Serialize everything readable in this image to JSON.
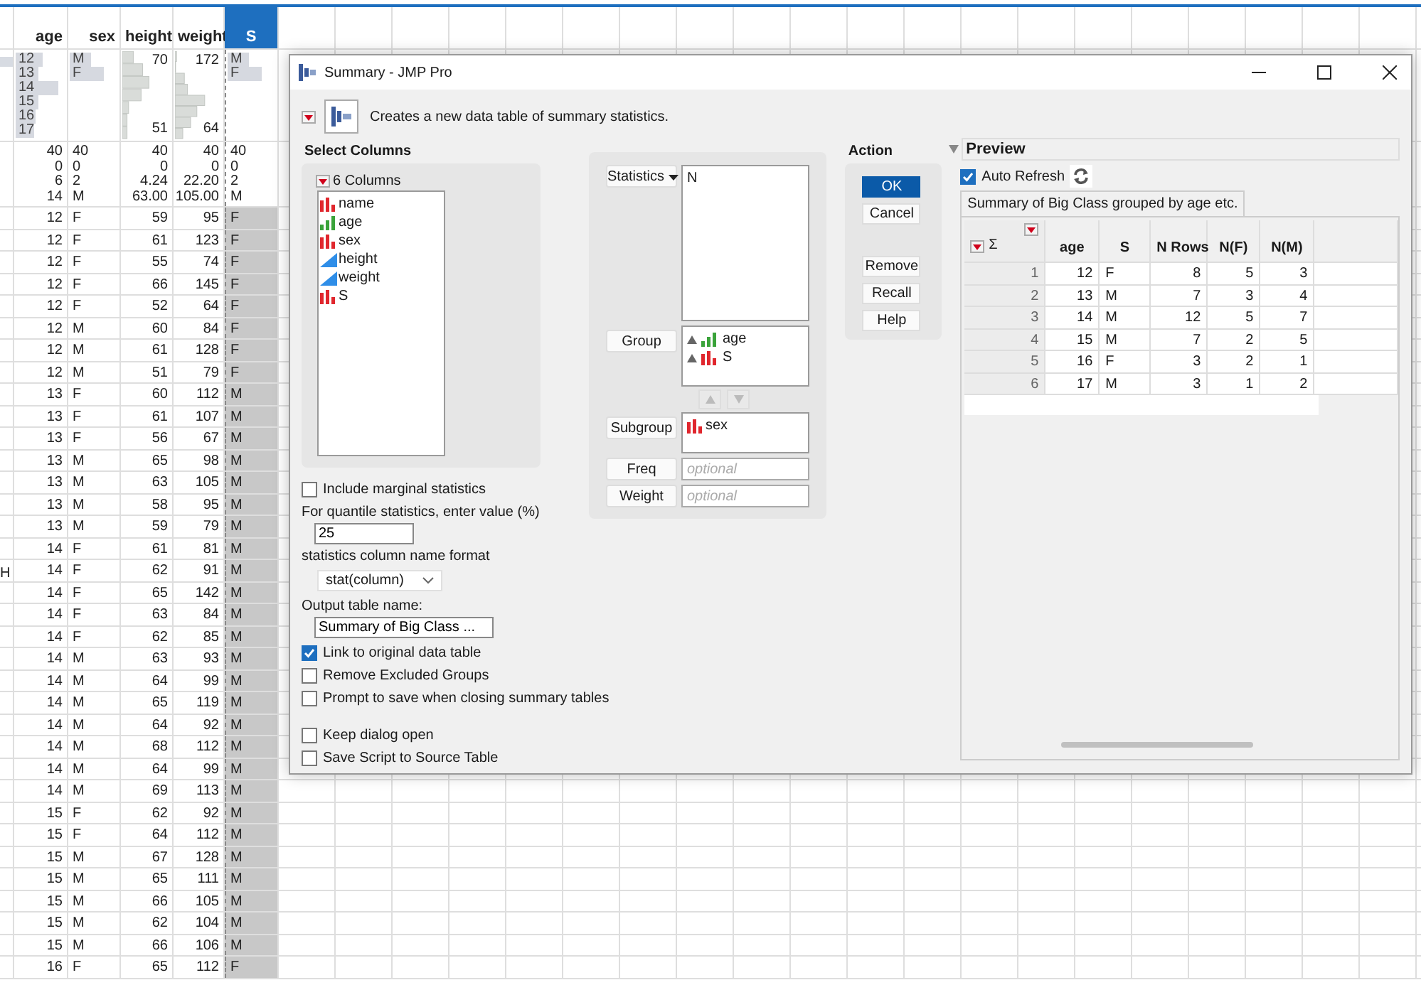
{
  "data_table": {
    "columns": [
      {
        "header": "age",
        "selected": false,
        "distribution": {
          "kind": "levels",
          "labels": [
            "12",
            "13",
            "14",
            "15",
            "16",
            "17"
          ]
        },
        "stats": [
          "40",
          "0",
          "6",
          "14"
        ]
      },
      {
        "header": "sex",
        "selected": false,
        "distribution": {
          "kind": "levels",
          "labels": [
            "M",
            "F"
          ]
        },
        "stats": [
          "40",
          "0",
          "2",
          "M"
        ]
      },
      {
        "header": "height",
        "selected": false,
        "distribution": {
          "kind": "histogram",
          "max": "70",
          "min": "51"
        },
        "stats": [
          "40",
          "0",
          "4.24",
          "63.00"
        ]
      },
      {
        "header": "weight",
        "selected": false,
        "distribution": {
          "kind": "histogram",
          "max": "172",
          "min": "64"
        },
        "stats": [
          "40",
          "0",
          "22.20",
          "105.00"
        ]
      },
      {
        "header": "S",
        "selected": true,
        "distribution": {
          "kind": "levels",
          "labels": [
            "M",
            "F"
          ]
        },
        "stats": [
          "40",
          "0",
          "2",
          "M"
        ]
      }
    ],
    "rows": [
      {
        "cells": [
          "12",
          "F",
          "59",
          "95",
          "F"
        ]
      },
      {
        "cells": [
          "12",
          "F",
          "61",
          "123",
          "F"
        ]
      },
      {
        "cells": [
          "12",
          "F",
          "55",
          "74",
          "F"
        ]
      },
      {
        "cells": [
          "12",
          "F",
          "66",
          "145",
          "F"
        ]
      },
      {
        "cells": [
          "12",
          "F",
          "52",
          "64",
          "F"
        ]
      },
      {
        "cells": [
          "12",
          "M",
          "60",
          "84",
          "F"
        ]
      },
      {
        "cells": [
          "12",
          "M",
          "61",
          "128",
          "F"
        ]
      },
      {
        "cells": [
          "12",
          "M",
          "51",
          "79",
          "F"
        ]
      },
      {
        "cells": [
          "13",
          "F",
          "60",
          "112",
          "M"
        ]
      },
      {
        "cells": [
          "13",
          "F",
          "61",
          "107",
          "M"
        ]
      },
      {
        "cells": [
          "13",
          "F",
          "56",
          "67",
          "M"
        ]
      },
      {
        "cells": [
          "13",
          "M",
          "65",
          "98",
          "M"
        ]
      },
      {
        "cells": [
          "13",
          "M",
          "63",
          "105",
          "M"
        ]
      },
      {
        "cells": [
          "13",
          "M",
          "58",
          "95",
          "M"
        ]
      },
      {
        "cells": [
          "13",
          "M",
          "59",
          "79",
          "M"
        ]
      },
      {
        "cells": [
          "14",
          "F",
          "61",
          "81",
          "M"
        ]
      },
      {
        "name_fragment": "H",
        "cells": [
          "14",
          "F",
          "62",
          "91",
          "M"
        ]
      },
      {
        "cells": [
          "14",
          "F",
          "65",
          "142",
          "M"
        ]
      },
      {
        "cells": [
          "14",
          "F",
          "63",
          "84",
          "M"
        ]
      },
      {
        "cells": [
          "14",
          "F",
          "62",
          "85",
          "M"
        ]
      },
      {
        "cells": [
          "14",
          "M",
          "63",
          "93",
          "M"
        ]
      },
      {
        "cells": [
          "14",
          "M",
          "64",
          "99",
          "M"
        ]
      },
      {
        "cells": [
          "14",
          "M",
          "65",
          "119",
          "M"
        ]
      },
      {
        "cells": [
          "14",
          "M",
          "64",
          "92",
          "M"
        ]
      },
      {
        "cells": [
          "14",
          "M",
          "68",
          "112",
          "M"
        ]
      },
      {
        "cells": [
          "14",
          "M",
          "64",
          "99",
          "M"
        ]
      },
      {
        "cells": [
          "14",
          "M",
          "69",
          "113",
          "M"
        ]
      },
      {
        "cells": [
          "15",
          "F",
          "62",
          "92",
          "M"
        ]
      },
      {
        "cells": [
          "15",
          "F",
          "64",
          "112",
          "M"
        ]
      },
      {
        "cells": [
          "15",
          "M",
          "67",
          "128",
          "M"
        ]
      },
      {
        "cells": [
          "15",
          "M",
          "65",
          "111",
          "M"
        ]
      },
      {
        "cells": [
          "15",
          "M",
          "66",
          "105",
          "M"
        ]
      },
      {
        "cells": [
          "15",
          "M",
          "62",
          "104",
          "M"
        ]
      },
      {
        "cells": [
          "15",
          "M",
          "66",
          "106",
          "M"
        ]
      },
      {
        "cells": [
          "16",
          "F",
          "65",
          "112",
          "F"
        ]
      }
    ]
  },
  "dialog": {
    "title": "Summary - JMP Pro",
    "description": "Creates a new data table of summary statistics.",
    "select_columns": {
      "heading": "Select Columns",
      "count_label": "6 Columns",
      "items": [
        {
          "name": "name",
          "kind": "nominal"
        },
        {
          "name": "age",
          "kind": "ordinal"
        },
        {
          "name": "sex",
          "kind": "nominal"
        },
        {
          "name": "height",
          "kind": "continuous"
        },
        {
          "name": "weight",
          "kind": "continuous"
        },
        {
          "name": "S",
          "kind": "nominal"
        }
      ]
    },
    "marginal": {
      "label": "Include marginal statistics",
      "checked": false
    },
    "quantile": {
      "label": "For quantile statistics, enter value (%)",
      "value": "25"
    },
    "name_format": {
      "label": "statistics column name format",
      "value": "stat(column)"
    },
    "output_name": {
      "label": "Output table name:",
      "value": "Summary of Big Class ..."
    },
    "checkboxes": [
      {
        "label": "Link to original data table",
        "checked": true
      },
      {
        "label": "Remove Excluded Groups",
        "checked": false
      },
      {
        "label": "Prompt to save when closing summary tables",
        "checked": false
      }
    ],
    "checkboxes_2": [
      {
        "label": "Keep dialog open",
        "checked": false
      },
      {
        "label": "Save Script to Source Table",
        "checked": false
      }
    ],
    "roles": [
      {
        "button": "Statistics",
        "kind": "menu",
        "items": [
          {
            "name": "N"
          }
        ]
      },
      {
        "button": "Group",
        "kind": "ordered",
        "items": [
          {
            "name": "age",
            "kind": "ordinal"
          },
          {
            "name": "S",
            "kind": "nominal"
          }
        ]
      },
      {
        "button": "Subgroup",
        "kind": "list",
        "items": [
          {
            "name": "sex",
            "kind": "nominal"
          }
        ]
      },
      {
        "button": "Freq",
        "kind": "optional",
        "placeholder": "optional"
      },
      {
        "button": "Weight",
        "kind": "optional",
        "placeholder": "optional"
      }
    ],
    "action": {
      "heading": "Action",
      "buttons": [
        {
          "label": "OK",
          "primary": true
        },
        {
          "label": "Cancel",
          "primary": false
        }
      ],
      "buttons_2": [
        {
          "label": "Remove"
        },
        {
          "label": "Recall"
        },
        {
          "label": "Help"
        }
      ]
    },
    "preview": {
      "heading": "Preview",
      "auto_refresh": {
        "label": "Auto Refresh",
        "checked": true
      },
      "tab": "Summary of Big Class grouped by age etc.",
      "corner_symbol": "Σ",
      "columns": [
        "age",
        "S",
        "N Rows",
        "N(F)",
        "N(M)"
      ],
      "rows": [
        {
          "number": "1",
          "cells": [
            "12",
            "F",
            "8",
            "5",
            "3"
          ]
        },
        {
          "number": "2",
          "cells": [
            "13",
            "M",
            "7",
            "3",
            "4"
          ]
        },
        {
          "number": "3",
          "cells": [
            "14",
            "M",
            "12",
            "5",
            "7"
          ]
        },
        {
          "number": "4",
          "cells": [
            "15",
            "M",
            "7",
            "2",
            "5"
          ]
        },
        {
          "number": "5",
          "cells": [
            "16",
            "F",
            "3",
            "2",
            "1"
          ]
        },
        {
          "number": "6",
          "cells": [
            "17",
            "M",
            "3",
            "1",
            "2"
          ]
        }
      ]
    }
  }
}
